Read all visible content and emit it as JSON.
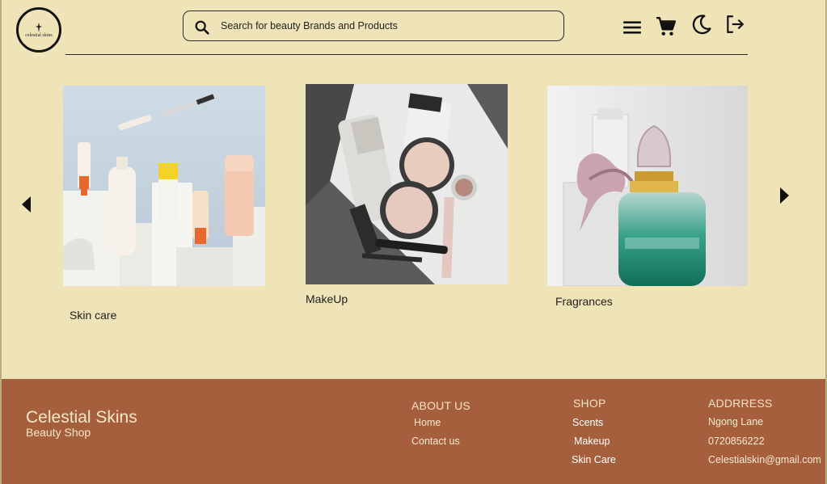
{
  "header": {
    "logo_text": "celestial skins",
    "search_placeholder": "Search for beauty Brands and Products"
  },
  "icons": {
    "search": "search-icon",
    "menu": "menu-icon",
    "cart": "cart-icon",
    "theme": "moon-icon",
    "logout": "logout-icon",
    "prev": "arrow-left-icon",
    "next": "arrow-right-icon"
  },
  "categories": [
    {
      "label": "Skin care"
    },
    {
      "label": "MakeUp"
    },
    {
      "label": "Fragrances"
    }
  ],
  "footer": {
    "brand_name": "Celestial Skins",
    "brand_sub": "Beauty Shop",
    "about": {
      "heading": "ABOUT US",
      "links": [
        "Home",
        "Contact us"
      ]
    },
    "shop": {
      "heading": "SHOP",
      "links": [
        "Scents",
        "Makeup",
        "Skin Care"
      ]
    },
    "address": {
      "heading": "ADDRRESS",
      "lines": [
        "Ngong Lane",
        "0720856222",
        "Celestialskin@gmail.com"
      ]
    }
  },
  "colors": {
    "background": "#efe4b8",
    "footer": "#a65f3c",
    "footer_text": "#f5e7c6"
  }
}
